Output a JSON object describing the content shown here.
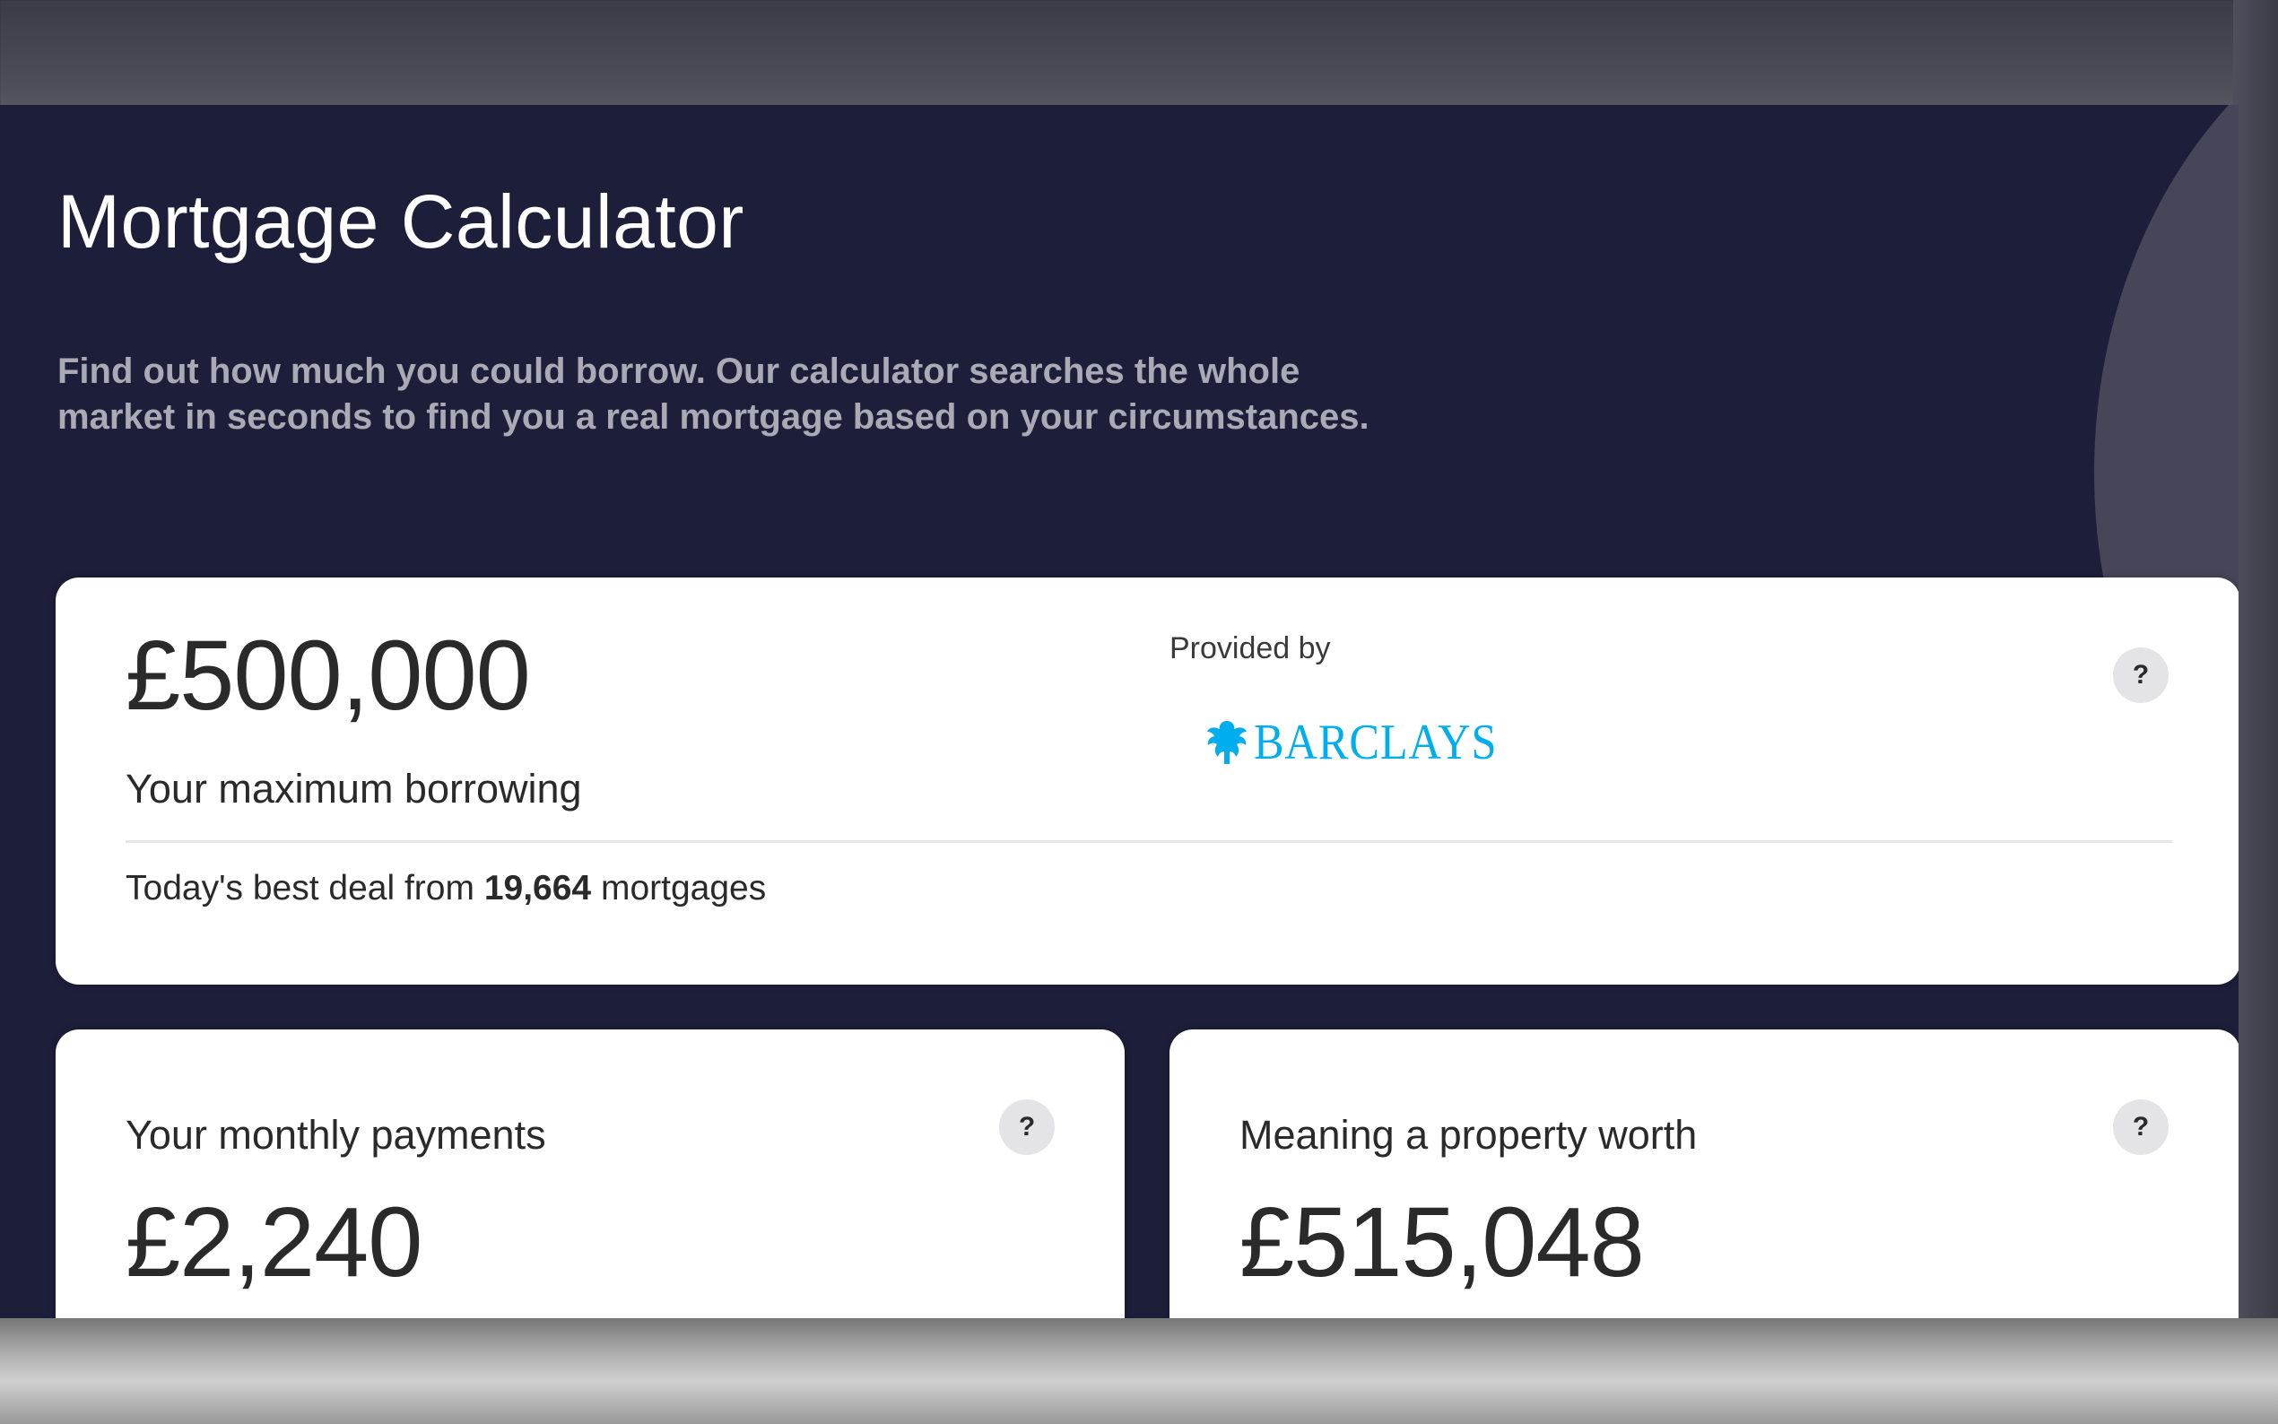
{
  "header": {
    "title": "Mortgage Calculator",
    "subtitle_line1": "Find out how much you could borrow. Our calculator searches the whole",
    "subtitle_line2": "market in seconds to find you a real mortgage based on your circumstances."
  },
  "borrowing": {
    "amount": "£500,000",
    "label": "Your maximum borrowing",
    "provided_by": "Provided by",
    "provider": "BARCLAYS",
    "best_deal_prefix": "Today's best deal from",
    "mortgage_count": "19,664",
    "best_deal_suffix": "mortgages",
    "help": "?"
  },
  "monthly": {
    "label": "Your monthly payments",
    "amount": "£2,240",
    "help": "?"
  },
  "property": {
    "label": "Meaning a property worth",
    "amount": "£515,048",
    "help": "?"
  },
  "colors": {
    "panel_bg": "#1d1e3a",
    "card_bg": "#ffffff",
    "brand_accent": "#00aeef",
    "subtitle_text": "#a9aab4"
  },
  "icons": {
    "help": "question-mark-icon",
    "provider_logo": "eagle-icon"
  }
}
